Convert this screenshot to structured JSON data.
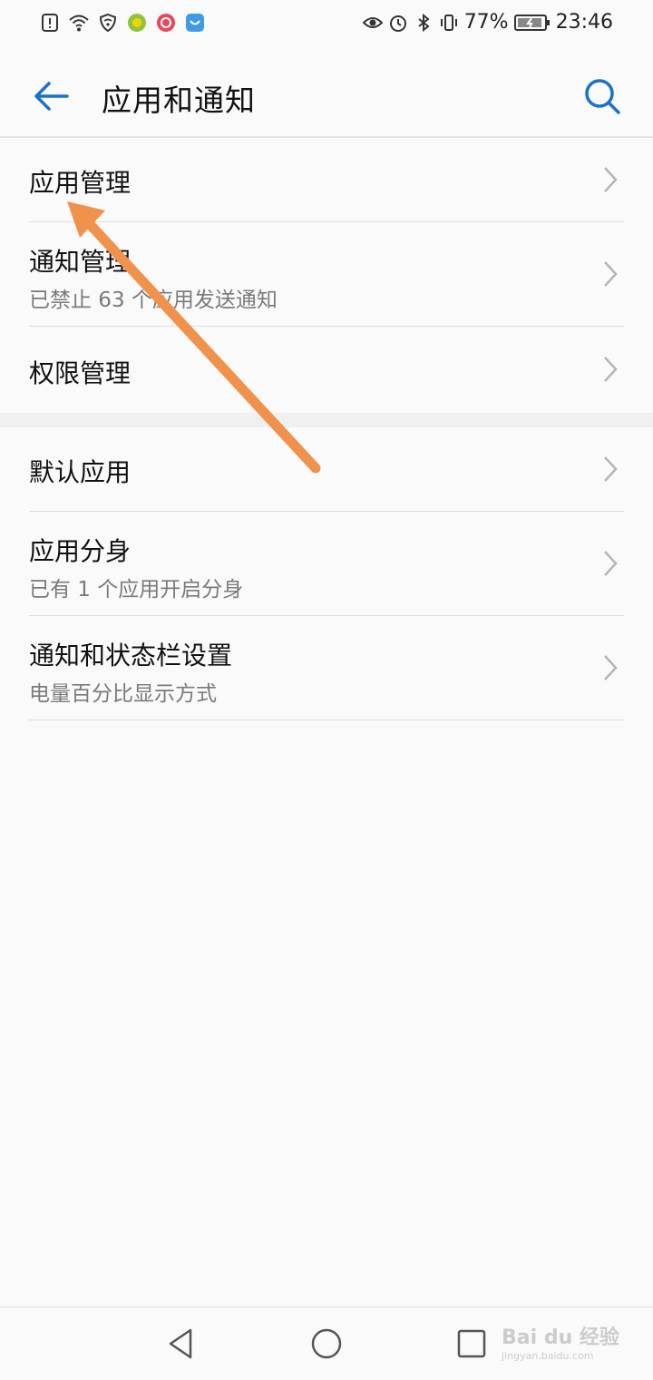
{
  "status_bar": {
    "battery_percent": "77%",
    "time": "23:46"
  },
  "header": {
    "title": "应用和通知"
  },
  "sections": [
    {
      "items": [
        {
          "title": "应用管理",
          "subtitle": ""
        },
        {
          "title": "通知管理",
          "subtitle": "已禁止 63 个应用发送通知"
        },
        {
          "title": "权限管理",
          "subtitle": ""
        }
      ]
    },
    {
      "items": [
        {
          "title": "默认应用",
          "subtitle": ""
        },
        {
          "title": "应用分身",
          "subtitle": "已有 1 个应用开启分身"
        },
        {
          "title": "通知和状态栏设置",
          "subtitle": "电量百分比显示方式"
        }
      ]
    }
  ],
  "watermark": {
    "brand": "Bai du 经验",
    "url": "jingyan.baidu.com"
  },
  "colors": {
    "accent": "#1a73c8",
    "annotation_arrow": "#f0914c"
  }
}
